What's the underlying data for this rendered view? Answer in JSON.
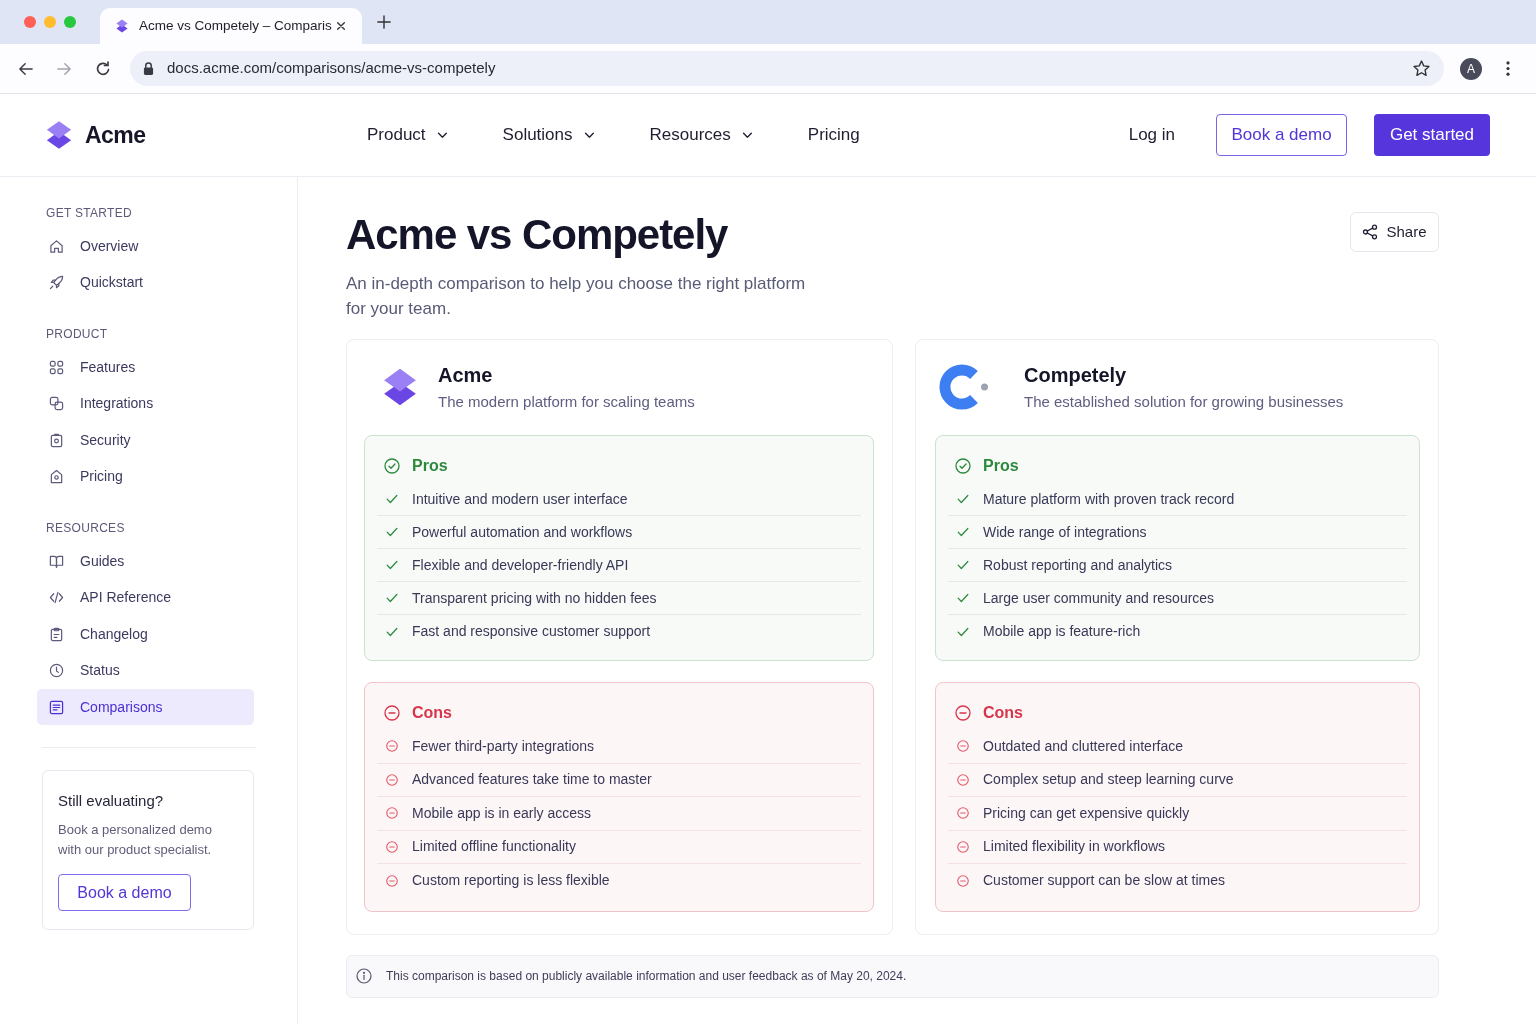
{
  "browser": {
    "tab_title": "Acme vs Competely – Comparis",
    "url": "docs.acme.com/comparisons/acme-vs-competely",
    "profile": "A"
  },
  "header": {
    "brand": "Acme",
    "nav": [
      {
        "label": "Product",
        "dropdown": true
      },
      {
        "label": "Solutions",
        "dropdown": true
      },
      {
        "label": "Resources",
        "dropdown": true
      },
      {
        "label": "Pricing",
        "dropdown": false
      }
    ],
    "login": "Log in",
    "book_demo": "Book a demo",
    "get_started": "Get started"
  },
  "sidebar": {
    "sections": [
      {
        "title": "GET STARTED",
        "items": [
          {
            "label": "Overview",
            "selected": false
          },
          {
            "label": "Quickstart",
            "selected": false
          }
        ]
      },
      {
        "title": "PRODUCT",
        "items": [
          {
            "label": "Features",
            "selected": false
          },
          {
            "label": "Integrations",
            "selected": false
          },
          {
            "label": "Security",
            "selected": false
          },
          {
            "label": "Pricing",
            "selected": false
          }
        ]
      },
      {
        "title": "RESOURCES",
        "items": [
          {
            "label": "Guides",
            "selected": false
          },
          {
            "label": "API Reference",
            "selected": false
          },
          {
            "label": "Changelog",
            "selected": false
          },
          {
            "label": "Status",
            "selected": false
          },
          {
            "label": "Comparisons",
            "selected": true
          }
        ]
      }
    ],
    "promo": {
      "title": "Still evaluating?",
      "text": "Book a personalized demo with our product specialist.",
      "button": "Book a demo"
    }
  },
  "page": {
    "title": "Acme vs Competely",
    "subtitle": "An in-depth comparison to help you choose the right platform for your team.",
    "share": "Share"
  },
  "products": [
    {
      "name": "Acme",
      "tagline": "The modern platform for scaling teams",
      "sections": [
        {
          "kind": "pros",
          "title": "Pros",
          "items": [
            "Intuitive and modern user interface",
            "Powerful automation and workflows",
            "Flexible and developer-friendly API",
            "Transparent pricing with no hidden fees",
            "Fast and responsive customer support"
          ]
        },
        {
          "kind": "cons",
          "title": "Cons",
          "items": [
            "Fewer third-party integrations",
            "Advanced features take time to master",
            "Mobile app is in early access",
            "Limited offline functionality",
            "Custom reporting is less flexible"
          ]
        }
      ]
    },
    {
      "name": "Competely",
      "tagline": "The established solution for growing businesses",
      "sections": [
        {
          "kind": "pros",
          "title": "Pros",
          "items": [
            "Mature platform with proven track record",
            "Wide range of integrations",
            "Robust reporting and analytics",
            "Large user community and resources",
            "Mobile app is feature-rich"
          ]
        },
        {
          "kind": "cons",
          "title": "Cons",
          "items": [
            "Outdated and cluttered interface",
            "Complex setup and steep learning curve",
            "Pricing can get expensive quickly",
            "Limited flexibility in workflows",
            "Customer support can be slow at times"
          ]
        }
      ]
    }
  ],
  "note": "This comparison is based on publicly available information and user feedback as of May 20, 2024."
}
